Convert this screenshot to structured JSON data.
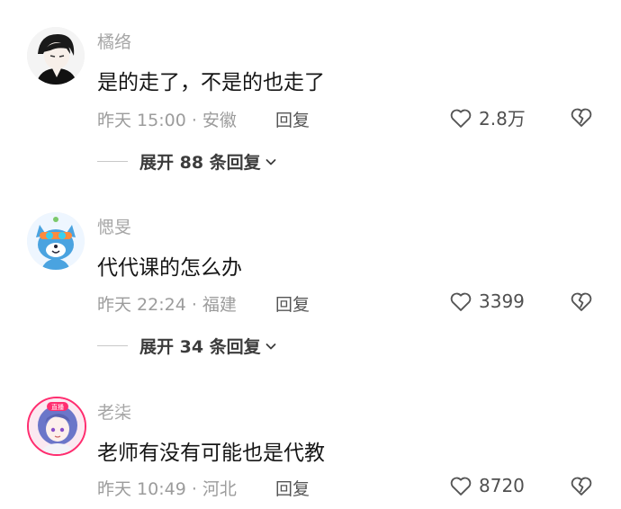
{
  "comments": [
    {
      "username": "橘络",
      "avatar_icon": "anime-boy-avatar-icon",
      "text": "是的走了，不是的也走了",
      "meta": "昨天 15:00 · 安徽",
      "reply_label": "回复",
      "likes": "2.8万",
      "expand_label": "展开 88 条回复"
    },
    {
      "username": "愢旻",
      "avatar_icon": "blue-fox-avatar-icon",
      "text": "代代课的怎么办",
      "meta": "昨天 22:24 · 福建",
      "reply_label": "回复",
      "likes": "3399",
      "expand_label": "展开 34 条回复"
    },
    {
      "username": "老柒",
      "avatar_icon": "anime-girl-avatar-icon",
      "avatar_badge": "直播",
      "text": "老师有没有可能也是代教",
      "meta": "昨天 10:49 · 河北",
      "reply_label": "回复",
      "likes": "8720"
    }
  ],
  "icons": {
    "like": "heart-outline-icon",
    "dislike": "broken-heart-icon",
    "expand": "chevron-down-icon"
  },
  "colors": {
    "username": "#a6a6a6",
    "text": "#161616",
    "meta": "#9c9c9c",
    "live_badge": "#ff2d6f"
  }
}
